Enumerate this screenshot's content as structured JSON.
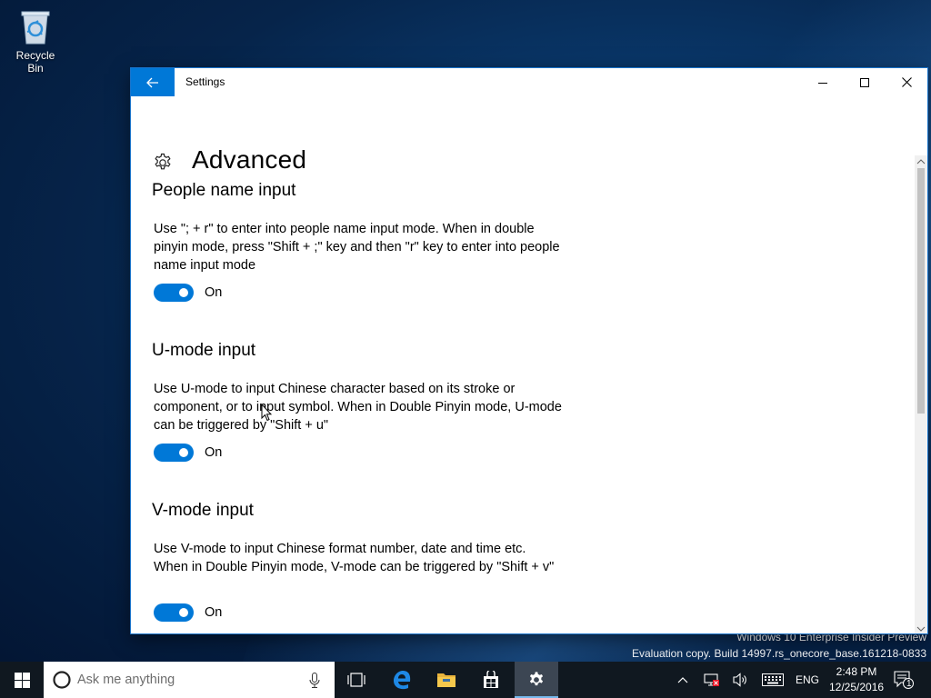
{
  "desktop": {
    "recycle_bin_label": "Recycle Bin",
    "watermark_line1": "Windows 10 Enterprise Insider Preview",
    "watermark_line2": "Evaluation copy. Build 14997.rs_onecore_base.161218-0833"
  },
  "window": {
    "title": "Settings",
    "page_title": "Advanced",
    "accent_color": "#0078d7",
    "sections": [
      {
        "title": "People name input",
        "description": "Use \"; + r\" to enter into people name input mode. When in double pinyin mode, press \"Shift + ;\" key and then \"r\" key to enter into people name input mode",
        "toggle_state": "On",
        "toggle_on": true
      },
      {
        "title": "U-mode input",
        "description": "Use U-mode to input Chinese character based on its stroke or component, or to input symbol. When in Double Pinyin mode, U-mode can be triggered by \"Shift + u\"",
        "toggle_state": "On",
        "toggle_on": true
      },
      {
        "title": "V-mode input",
        "description": "Use V-mode to input Chinese format number, date and time etc. When in Double Pinyin mode, V-mode can be triggered by \"Shift + v\"",
        "toggle_state": "On",
        "toggle_on": true
      }
    ]
  },
  "taskbar": {
    "search_placeholder": "Ask me anything",
    "language": "ENG",
    "time": "2:48 PM",
    "date": "12/25/2016",
    "notification_count": "1",
    "pinned": [
      "task-view-icon",
      "edge-icon",
      "file-explorer-icon",
      "store-icon",
      "settings-icon"
    ]
  }
}
